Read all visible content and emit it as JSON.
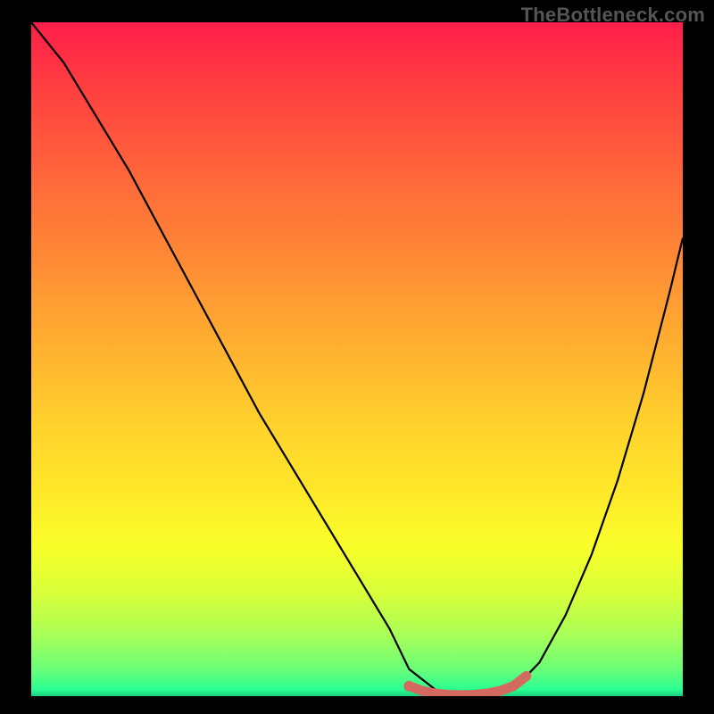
{
  "watermark": "TheBottleneck.com",
  "chart_data": {
    "type": "line",
    "title": "",
    "xlabel": "",
    "ylabel": "",
    "xlim": [
      0,
      100
    ],
    "ylim": [
      0,
      100
    ],
    "series": [
      {
        "name": "bottleneck-curve",
        "color": "#000000",
        "x": [
          0,
          5,
          10,
          15,
          20,
          25,
          30,
          35,
          40,
          45,
          50,
          55,
          58,
          62,
          66,
          70,
          74,
          78,
          82,
          86,
          90,
          94,
          98,
          100
        ],
        "values": [
          100,
          94,
          86,
          78,
          69,
          60,
          51,
          42,
          34,
          26,
          18,
          10,
          4,
          1,
          0,
          0,
          1,
          5,
          12,
          21,
          32,
          45,
          60,
          68
        ]
      },
      {
        "name": "optimal-highlight",
        "color": "#d46a5f",
        "x": [
          58,
          60,
          62,
          64,
          66,
          68,
          70,
          72,
          74,
          76
        ],
        "values": [
          1.5,
          0.8,
          0.4,
          0.2,
          0.15,
          0.2,
          0.4,
          0.8,
          1.5,
          3.0
        ]
      }
    ],
    "background_gradient": {
      "top": "#ff1e4a",
      "mid": "#ffe92a",
      "bottom": "#18d080"
    }
  }
}
